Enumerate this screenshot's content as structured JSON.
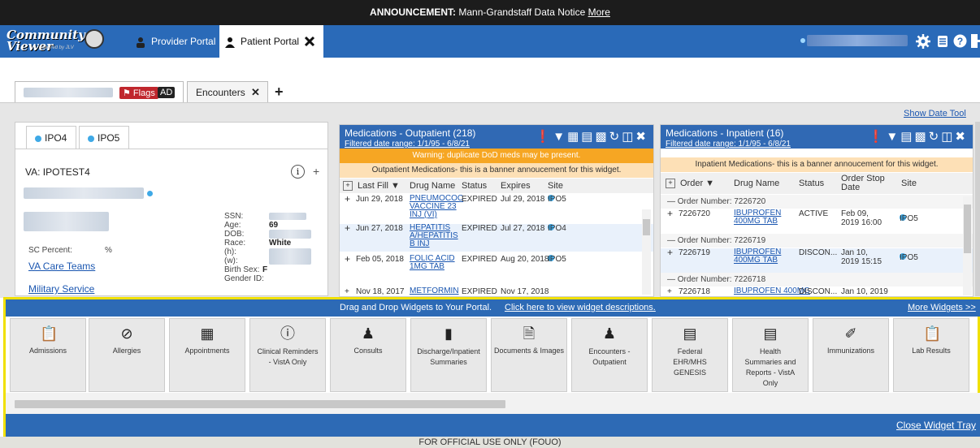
{
  "announcement": {
    "prefix": "ANNOUNCEMENT:",
    "text": "Mann-Grandstaff Data Notice",
    "link": "More"
  },
  "app": {
    "logo_line1": "Community",
    "logo_line2": "Viewer",
    "powered_by": "powered by JLV"
  },
  "portal_tabs": [
    {
      "label": "Provider Portal"
    },
    {
      "label": "Patient Portal"
    }
  ],
  "patient_tabs": {
    "flags_label": "Flags",
    "ad_label": "AD",
    "encounters_label": "Encounters"
  },
  "show_date_tool": "Show Date Tool",
  "patient_panel": {
    "site_tabs": [
      "IPO4",
      "IPO5"
    ],
    "va_id": "VA: IPOTEST4",
    "info_icon": "i",
    "plus": "+",
    "labels": {
      "ssn": "SSN:",
      "age": "Age:",
      "dob": "DOB:",
      "race": "Race:",
      "h": "(h):",
      "w": "(w):",
      "birth_sex": "Birth Sex:",
      "gender_id": "Gender ID:"
    },
    "age_value": "69",
    "race_value": "White",
    "birth_sex_value": "F",
    "sc_percent_label": "SC Percent:",
    "sc_percent_value": "%",
    "va_care_teams": "VA Care Teams",
    "military_service": "Military Service"
  },
  "med_outpatient": {
    "title": "Medications - Outpatient (218)",
    "filter": "Filtered date range: 1/1/95 - 6/8/21",
    "banner_warning": "Warning: duplicate DoD meds may be present.",
    "banner_info": "Outpatient Medications- this is a banner annoucement for this widget.",
    "columns": [
      "Last Fill",
      "Drug Name",
      "Status",
      "Expires",
      "Site"
    ],
    "rows": [
      {
        "last_fill": "Jun 29, 2018",
        "drug": "PNEUMOCOC VACCINE 23 INJ (VI)",
        "status": "EXPIRED",
        "expires": "Jul 29, 2018",
        "site": "IPO5"
      },
      {
        "last_fill": "Jun 27, 2018",
        "drug": "HEPATITIS A/HEPATITIS B INJ",
        "status": "EXPIRED",
        "expires": "Jul 27, 2018",
        "site": "IPO4"
      },
      {
        "last_fill": "Feb 05, 2018",
        "drug": "FOLIC ACID 1MG TAB",
        "status": "EXPIRED",
        "expires": "Aug 20, 2018",
        "site": "IPO5"
      },
      {
        "last_fill": "Nov 18, 2017",
        "drug": "METFORMIN",
        "status": "EXPIRED",
        "expires": "Nov 17, 2018",
        "site": ""
      }
    ]
  },
  "med_inpatient": {
    "title": "Medications - Inpatient (16)",
    "filter": "Filtered date range: 1/1/95 - 6/8/21",
    "banner_info": "Inpatient Medications- this is a banner annoucement for this widget.",
    "columns": [
      "Order",
      "Drug Name",
      "Status",
      "Order Stop Date",
      "Site"
    ],
    "groups": [
      {
        "label": "Order Number: 7226720",
        "order": "7226720",
        "drug": "IBUPROFEN 400MG TAB",
        "status": "ACTIVE",
        "stop": "Feb 09, 2019 16:00",
        "site": "IPO5"
      },
      {
        "label": "Order Number: 7226719",
        "order": "7226719",
        "drug": "IBUPROFEN 400MG TAB",
        "status": "DISCON...",
        "stop": "Jan 10, 2019 15:15",
        "site": "IPO5"
      },
      {
        "label": "Order Number: 7226718",
        "order": "7226718",
        "drug": "IBUPROFEN 400MG",
        "status": "DISCON...",
        "stop": "Jan 10, 2019",
        "site": "IPO5"
      }
    ]
  },
  "widget_tray": {
    "instruction": "Drag and Drop Widgets to Your Portal.",
    "descriptions_link": "Click here to view widget descriptions.",
    "more_widgets": "More Widgets >>",
    "close_tray": "Close Widget Tray",
    "widgets": [
      {
        "label": "Admissions",
        "icon": "clipboard-icon"
      },
      {
        "label": "Allergies",
        "icon": "ban-icon"
      },
      {
        "label": "Appointments",
        "icon": "calendar-icon"
      },
      {
        "label": "Clinical Reminders - VistA Only",
        "icon": "alert-icon"
      },
      {
        "label": "Consults",
        "icon": "doctor-icon"
      },
      {
        "label": "Discharge/Inpatient Summaries",
        "icon": "summary-icon"
      },
      {
        "label": "Documents & Images",
        "icon": "document-icon"
      },
      {
        "label": "Encounters - Outpatient",
        "icon": "person-icon"
      },
      {
        "label": "Federal EHR/MHS GENESIS",
        "icon": "window-icon"
      },
      {
        "label": "Health Summaries and Reports - VistA Only",
        "icon": "window-icon"
      },
      {
        "label": "Immunizations",
        "icon": "syringe-icon"
      },
      {
        "label": "Lab Results",
        "icon": "clipboard-icon"
      }
    ]
  },
  "footer": "FOR OFFICIAL USE ONLY (FOUO)"
}
